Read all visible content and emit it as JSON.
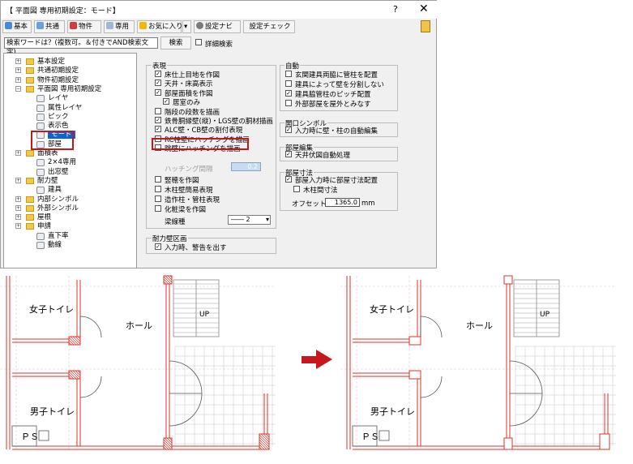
{
  "window": {
    "title": "【 平面図 専用初期設定：モード】",
    "help": "?",
    "close": "✕"
  },
  "toolbar": {
    "basic": "基本",
    "common": "共通",
    "property": "物件",
    "dedicated": "専用",
    "favorites": "お気に入り",
    "dropdown": "▾",
    "settings_navi": "設定ナビ",
    "settings_check": "設定チェック"
  },
  "search": {
    "value": "検索ワードは？(複数可。＆付きでAND検索文字)",
    "button": "検索",
    "detail_label": "詳細検索"
  },
  "tree": {
    "items": [
      {
        "label": "基本設定",
        "type": "folder",
        "expander": "+"
      },
      {
        "label": "共通初期設定",
        "type": "folder",
        "expander": "+"
      },
      {
        "label": "物件初期設定",
        "type": "folder",
        "expander": "+"
      },
      {
        "label": "平面図 専用初期設定",
        "type": "folder-open",
        "expander": "−"
      },
      {
        "label": "レイヤ",
        "type": "leaf"
      },
      {
        "label": "属性レイヤ",
        "type": "leaf"
      },
      {
        "label": "ピック",
        "type": "leaf"
      },
      {
        "label": "表示色",
        "type": "leaf"
      },
      {
        "label": "モード",
        "type": "leaf",
        "selected": true
      },
      {
        "label": "部屋",
        "type": "leaf"
      },
      {
        "label": "面積表",
        "type": "folder",
        "expander": "+"
      },
      {
        "label": "2×4専用",
        "type": "leaf"
      },
      {
        "label": "出窓壁",
        "type": "leaf"
      },
      {
        "label": "耐力壁",
        "type": "folder",
        "expander": "+"
      },
      {
        "label": "建具",
        "type": "leaf"
      },
      {
        "label": "内部シンボル",
        "type": "folder",
        "expander": "+"
      },
      {
        "label": "外部シンボル",
        "type": "folder",
        "expander": "+"
      },
      {
        "label": "屋根",
        "type": "folder",
        "expander": "+"
      },
      {
        "label": "申請",
        "type": "folder",
        "expander": "+"
      },
      {
        "label": "直下率",
        "type": "leaf"
      },
      {
        "label": "動線",
        "type": "leaf"
      }
    ]
  },
  "display_group": {
    "title": "表現",
    "options": [
      {
        "label": "床仕上目地を作図",
        "checked": true
      },
      {
        "label": "天井・床高表示",
        "checked": true
      },
      {
        "label": "部屋面積を作図",
        "checked": true
      },
      {
        "label": "居室のみ",
        "checked": true
      },
      {
        "label": "階段の段数を描画",
        "checked": false
      },
      {
        "label": "鉄骨胴縁壁(縦)・LGS壁の胴材描画",
        "checked": true
      },
      {
        "label": "ALC壁・CB壁の割付表現",
        "checked": true
      },
      {
        "label": "RC柱壁にハッチングを描画",
        "checked": false
      },
      {
        "label": "跳壁にハッチングを描画",
        "checked": false
      },
      {
        "label": "竪穂を作図",
        "checked": false
      },
      {
        "label": "木柱壁簡易表現",
        "checked": false
      },
      {
        "label": "造作柱・管柱表現",
        "checked": false
      },
      {
        "label": "化粧梁を作図",
        "checked": false
      }
    ],
    "hatch_pitch_label": "ハッチング間隔",
    "hatch_pitch_value": "0.2",
    "beam_line_label": "梁線種",
    "beam_line_value": "―― 2"
  },
  "bearing_group": {
    "title": "耐力壁区画",
    "options": [
      {
        "label": "入力時、警告を出す",
        "checked": true
      }
    ]
  },
  "auto_group": {
    "title": "自動",
    "options": [
      {
        "label": "玄関建具両脇に管柱を配置",
        "checked": false
      },
      {
        "label": "建具によって壁を分割しない",
        "checked": false
      },
      {
        "label": "建具脇管柱のピッチ配置",
        "checked": true
      },
      {
        "label": "外部部屋を屋外とみなす",
        "checked": false
      }
    ]
  },
  "opening_group": {
    "title": "開口シンボル",
    "options": [
      {
        "label": "入力時に壁・柱の自動編集",
        "checked": true
      }
    ]
  },
  "room_edit_group": {
    "title": "部屋編集",
    "options": [
      {
        "label": "天井伏図自動処理",
        "checked": true
      }
    ]
  },
  "room_dim_group": {
    "title": "部屋寸法",
    "options": [
      {
        "label": "部屋入力時に部屋寸法配置",
        "checked": true
      },
      {
        "label": "木柱間寸法",
        "checked": false
      }
    ],
    "offset_label": "オフセット",
    "offset_value": "1365.0",
    "offset_unit": "mm"
  },
  "plans": {
    "left": {
      "women": "女子トイレ",
      "men": "男子トイレ",
      "hall": "ホール",
      "up": "UP",
      "ps": "ＰＳ"
    },
    "right": {
      "women": "女子トイレ",
      "men": "男子トイレ",
      "hall": "ホール",
      "up": "UP",
      "ps": "ＰＳ"
    },
    "arrow_color": "#c8161d",
    "wall_color": "#e0302a"
  }
}
